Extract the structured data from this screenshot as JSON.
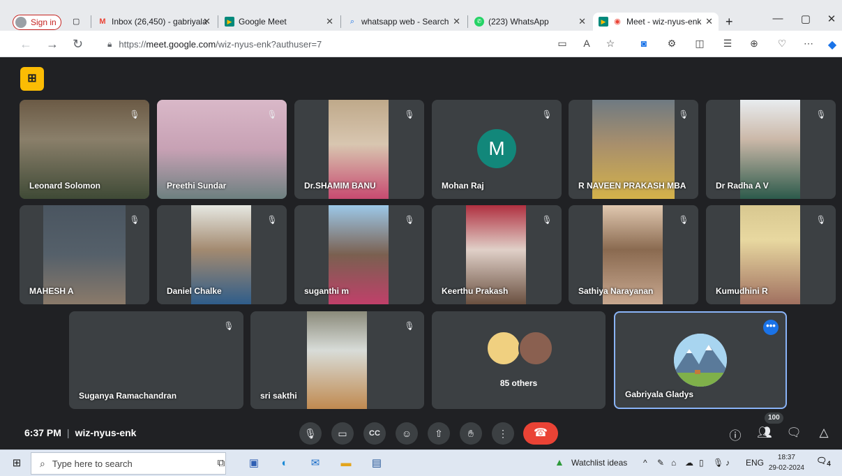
{
  "browser": {
    "signin_label": "Sign in",
    "tabs": [
      {
        "label": "Inbox (26,450) - gabriyala",
        "icon": "gmail-icon"
      },
      {
        "label": "Google Meet",
        "icon": "meet-icon"
      },
      {
        "label": "whatsapp web - Search",
        "icon": "search-icon"
      },
      {
        "label": "(223) WhatsApp",
        "icon": "whatsapp-icon"
      },
      {
        "label": "Meet - wiz-nyus-enk",
        "icon": "meet-icon",
        "active": true
      }
    ],
    "url_prefix": "https://",
    "url_host": "meet.google.com",
    "url_path": "/wiz-nyus-enk?authuser=7"
  },
  "participants": {
    "row1": [
      "Leonard Solomon",
      "Preethi Sundar",
      "Dr.SHAMIM BANU",
      "Mohan Raj",
      "R NAVEEN PRAKASH MBA",
      "Dr Radha A V"
    ],
    "row2": [
      "MAHESH A",
      "Daniel Chalke",
      "suganthi m",
      "Keerthu Prakash",
      "Sathiya Narayanan",
      "Kumudhini R"
    ],
    "row3": [
      "Suganya Ramachandran",
      "sri sakthi"
    ],
    "mohan_initial": "M",
    "others_label": "85 others",
    "self_name": "Gabriyala Gladys",
    "more_label": "•••"
  },
  "controls": {
    "time": "6:37 PM",
    "separator": "|",
    "meeting_code": "wiz-nyus-enk",
    "participant_count": "100"
  },
  "taskbar": {
    "search_placeholder": "Type here to search",
    "widget_label": "Watchlist ideas",
    "language": "ENG",
    "clock_time": "18:37",
    "clock_date": "29-02-2024",
    "notification_count": "4"
  },
  "colors": {
    "meet_bg": "#202124",
    "tile_bg": "#3c4043",
    "hangup": "#ea4335",
    "accent": "#8ab4f8",
    "avatar_green": "#12877a"
  }
}
